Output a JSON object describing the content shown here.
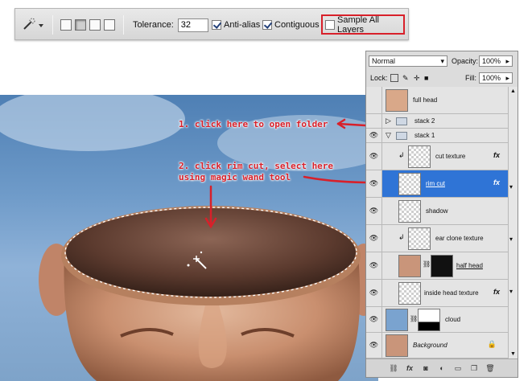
{
  "options_bar": {
    "tool_icon": "magic-wand-icon",
    "tolerance_label": "Tolerance:",
    "tolerance_value": "32",
    "anti_alias_label": "Anti-alias",
    "anti_alias_checked": true,
    "contiguous_label": "Contiguous",
    "contiguous_checked": true,
    "sample_all_layers_label": "Sample All Layers",
    "sample_all_layers_checked": false,
    "highlight_color": "#d8202a"
  },
  "annotations": {
    "step1": "1. click here to open folder",
    "step2_line1": "2. click rim cut, select here",
    "step2_line2": "using magic wand tool"
  },
  "layers_panel": {
    "blend_mode": "Normal",
    "opacity_label": "Opacity:",
    "opacity_value": "100%",
    "lock_label": "Lock:",
    "fill_label": "Fill:",
    "fill_value": "100%",
    "fx_label": "fx",
    "layers": [
      {
        "name": "full head",
        "visible": false
      },
      {
        "name": "stack 2",
        "type": "folder",
        "expanded": false,
        "visible": false
      },
      {
        "name": "stack 1",
        "type": "folder",
        "expanded": true,
        "visible": true
      },
      {
        "name": "cut texture",
        "visible": true,
        "fx": true,
        "clipped": true
      },
      {
        "name": "rim cut",
        "visible": true,
        "fx": true,
        "selected": true
      },
      {
        "name": "shadow",
        "visible": true
      },
      {
        "name": "ear clone texture",
        "visible": true,
        "clipped": true
      },
      {
        "name": "half head",
        "visible": true,
        "mask": true
      },
      {
        "name": "inside head texture",
        "visible": true,
        "fx": true
      },
      {
        "name": "cloud",
        "visible": true,
        "mask": true
      },
      {
        "name": "Background",
        "visible": true,
        "locked": true
      }
    ],
    "footer_link": "link-icon",
    "footer_fx": "fx",
    "active_color": "#2f74d6"
  }
}
